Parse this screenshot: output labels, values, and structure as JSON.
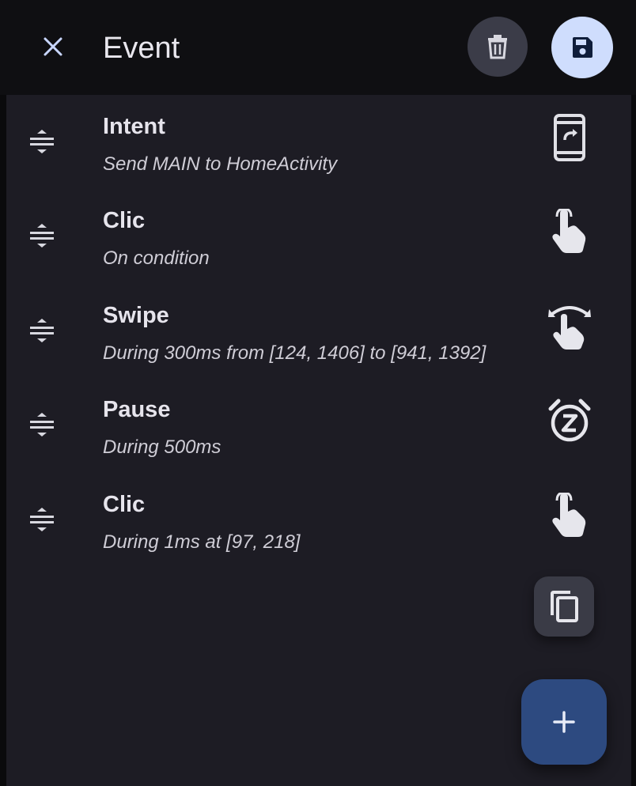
{
  "header": {
    "title": "Event",
    "close_icon": "close-icon",
    "delete_icon": "trash-icon",
    "save_icon": "save-icon"
  },
  "actions": [
    {
      "title": "Intent",
      "subtitle": "Send MAIN to HomeActivity",
      "icon": "intent-phone-icon"
    },
    {
      "title": "Clic",
      "subtitle": "On condition",
      "icon": "tap-icon"
    },
    {
      "title": "Swipe",
      "subtitle": "During 300ms from [124, 1406] to [941, 1392]",
      "icon": "swipe-icon"
    },
    {
      "title": "Pause",
      "subtitle": "During 500ms",
      "icon": "snooze-alarm-icon"
    },
    {
      "title": "Clic",
      "subtitle": "During 1ms at [97, 218]",
      "icon": "tap-icon"
    }
  ],
  "fabs": {
    "copy_icon": "copy-icon",
    "add_icon": "add-icon"
  },
  "colors": {
    "background": "#1d1c24",
    "topbar": "#0f0f12",
    "save_button": "#cfddfd",
    "add_button": "#2d4a80",
    "accent_icon": "#c8d6ff"
  }
}
